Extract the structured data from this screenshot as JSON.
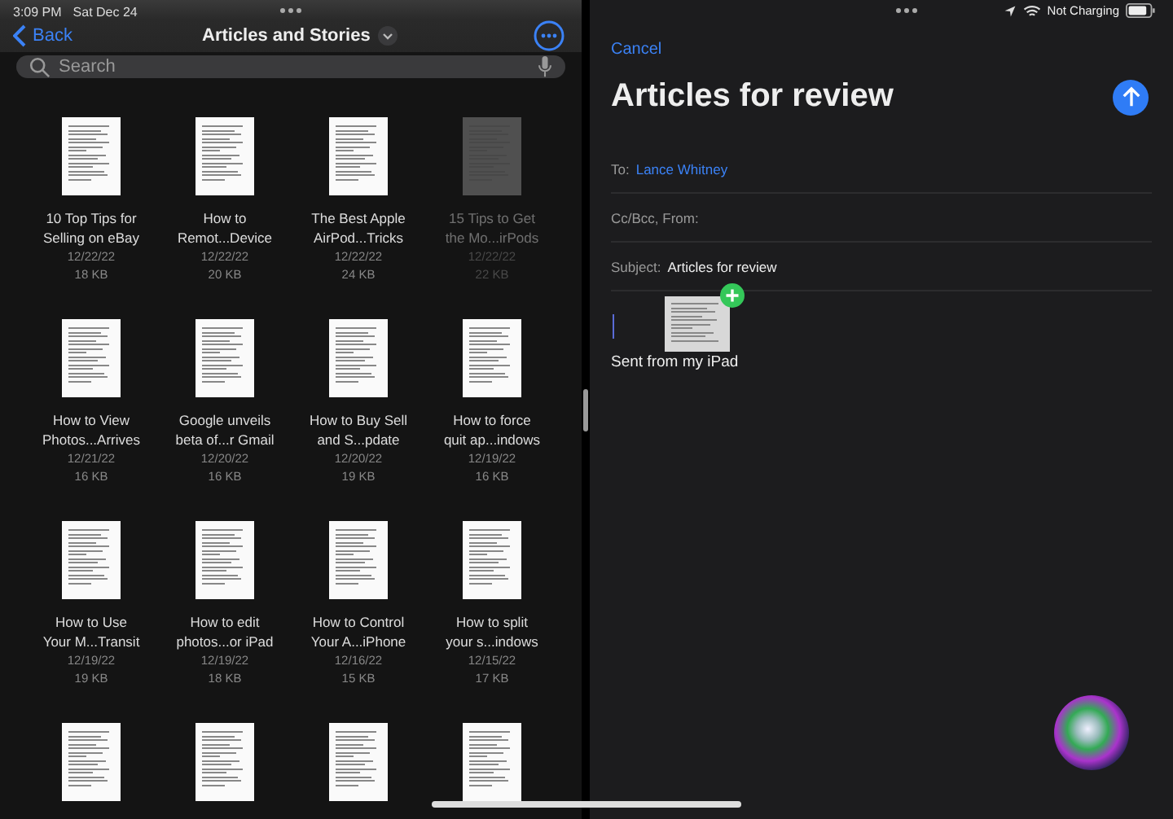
{
  "status_bar": {
    "time": "3:09 PM",
    "date": "Sat Dec 24",
    "battery_text": "Not Charging"
  },
  "files_app": {
    "back": "Back",
    "title": "Articles and Stories",
    "search": {
      "placeholder": "Search"
    },
    "files": [
      {
        "kind": "file",
        "title_1": "10 Top Tips for",
        "title_2": "Selling on eBay",
        "date": "12/22/22",
        "size": "18 KB",
        "dimmed": false
      },
      {
        "kind": "file",
        "title_1": "How to",
        "title_2": "Remot...Device",
        "date": "12/22/22",
        "size": "20 KB",
        "dimmed": false
      },
      {
        "kind": "file",
        "title_1": "The Best Apple",
        "title_2": "AirPod...Tricks",
        "date": "12/22/22",
        "size": "24 KB",
        "dimmed": false
      },
      {
        "kind": "file",
        "title_1": "15 Tips to Get",
        "title_2": "the Mo...irPods",
        "date": "12/22/22",
        "size": "22 KB",
        "dimmed": true
      },
      {
        "kind": "file",
        "title_1": "How to View",
        "title_2": "Photos...Arrives",
        "date": "12/21/22",
        "size": "16 KB",
        "dimmed": false
      },
      {
        "kind": "file",
        "title_1": "Google unveils",
        "title_2": "beta of...r Gmail",
        "date": "12/20/22",
        "size": "16 KB",
        "dimmed": false
      },
      {
        "kind": "file",
        "title_1": "How to Buy Sell",
        "title_2": "and S...pdate",
        "date": "12/20/22",
        "size": "19 KB",
        "dimmed": false
      },
      {
        "kind": "file",
        "title_1": "How to force",
        "title_2": "quit ap...indows",
        "date": "12/19/22",
        "size": "16 KB",
        "dimmed": false
      },
      {
        "kind": "file",
        "title_1": "How to Use",
        "title_2": "Your M...Transit",
        "date": "12/19/22",
        "size": "19 KB",
        "dimmed": false
      },
      {
        "kind": "file",
        "title_1": "How to edit",
        "title_2": "photos...or iPad",
        "date": "12/19/22",
        "size": "18 KB",
        "dimmed": false
      },
      {
        "kind": "file",
        "title_1": "How to Control",
        "title_2": "Your A...iPhone",
        "date": "12/16/22",
        "size": "15 KB",
        "dimmed": false
      },
      {
        "kind": "file",
        "title_1": "How to split",
        "title_2": "your s...indows",
        "date": "12/15/22",
        "size": "17 KB",
        "dimmed": false
      },
      {
        "kind": "cut_off"
      },
      {
        "kind": "cut_off"
      },
      {
        "kind": "cut_off"
      },
      {
        "kind": "cut_off"
      }
    ]
  },
  "mail": {
    "cancel": "Cancel",
    "heading": "Articles for review",
    "to_label": "To:",
    "to_value": "Lance Whitney",
    "cc_label": "Cc/Bcc, From:",
    "subject_label": "Subject:",
    "subject_value": "Articles for review",
    "body": "Sent from my iPad"
  }
}
